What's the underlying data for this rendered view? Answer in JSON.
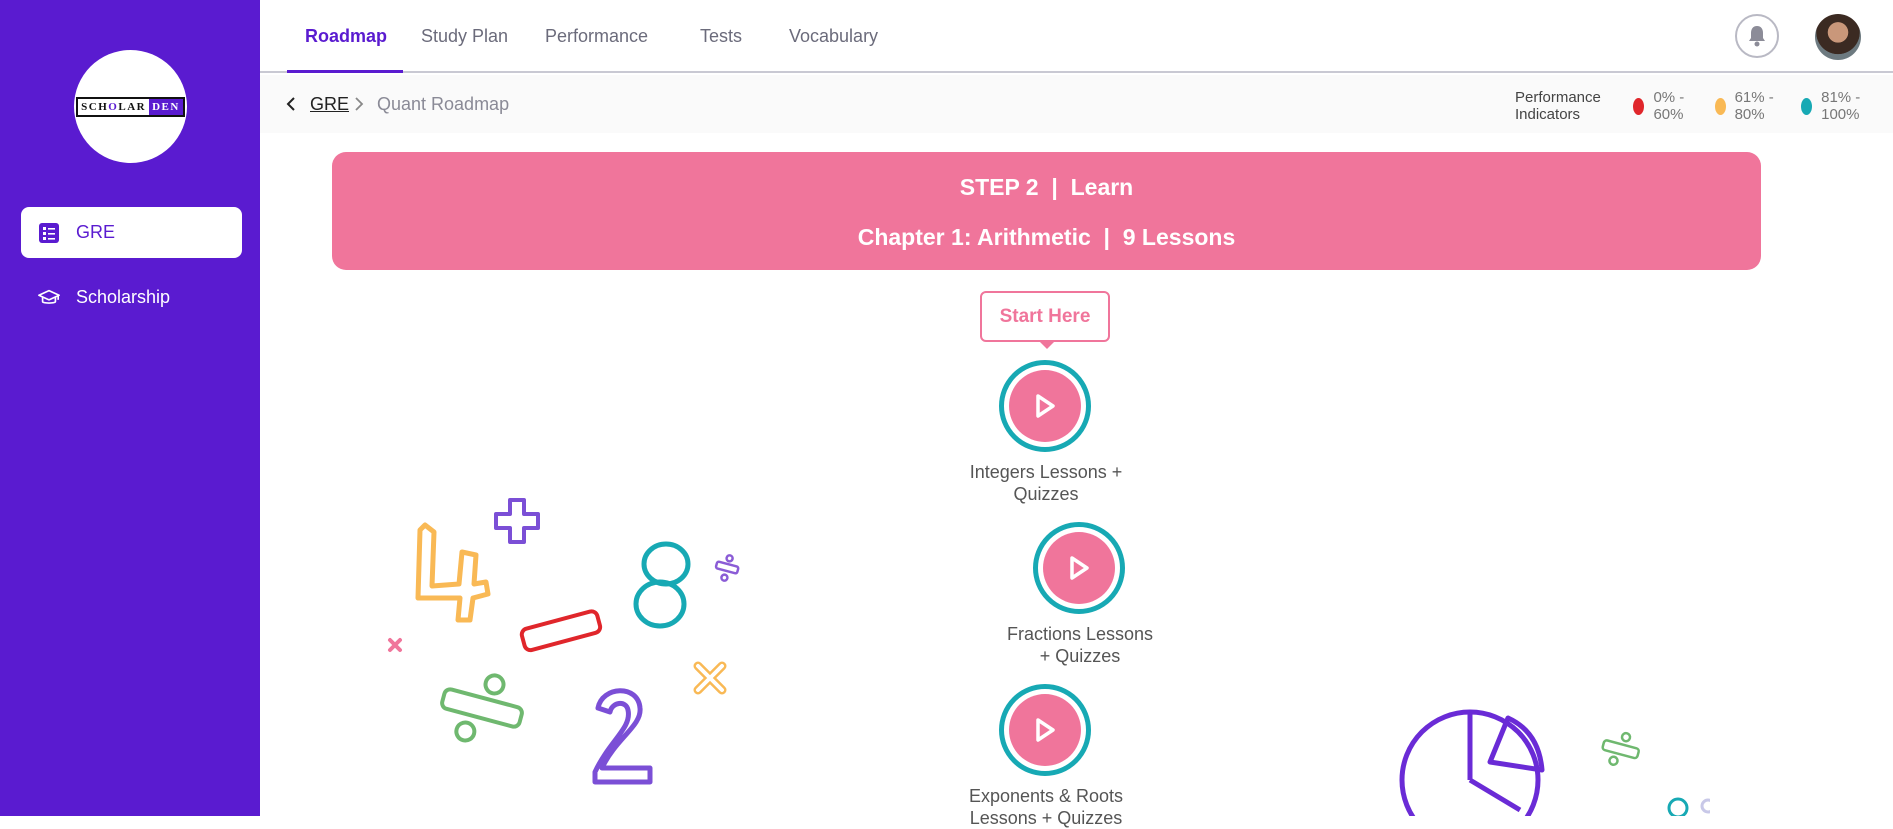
{
  "sidebar": {
    "logo_left": "SCH",
    "logo_mid": "O",
    "logo_l": "LAR",
    "logo_right": "DEN",
    "items": [
      {
        "label": "GRE",
        "icon": "list-icon",
        "active": true
      },
      {
        "label": "Scholarship",
        "icon": "graduation-cap-icon",
        "active": false
      }
    ]
  },
  "header": {
    "tabs": [
      {
        "label": "Roadmap",
        "active": true
      },
      {
        "label": "Study Plan",
        "active": false
      },
      {
        "label": "Performance",
        "active": false
      },
      {
        "label": "Tests",
        "active": false
      },
      {
        "label": "Vocabulary",
        "active": false
      }
    ],
    "bell_icon": "bell-icon",
    "avatar_icon": "user-avatar"
  },
  "breadcrumb": {
    "back_icon": "chevron-left-icon",
    "root": "GRE",
    "sep_icon": "chevron-right-icon",
    "current": "Quant Roadmap"
  },
  "performance": {
    "label": "Performance Indicators",
    "ranges": [
      {
        "range": "0% - 60%",
        "color": "#e0262b"
      },
      {
        "range": "61% - 80%",
        "color": "#f9b955"
      },
      {
        "range": "81% - 100%",
        "color": "#17a9b4"
      }
    ]
  },
  "banner": {
    "step_line": "STEP 2  |  Learn",
    "chapter_line": "Chapter 1: Arithmetic  |  9 Lessons",
    "color": "#f0759b"
  },
  "roadmap": {
    "start_label": "Start Here",
    "lessons": [
      {
        "line1": "Integers Lessons +",
        "line2": "Quizzes"
      },
      {
        "line1": "Fractions Lessons",
        "line2": "+ Quizzes"
      },
      {
        "line1": "Exponents & Roots",
        "line2": "Lessons + Quizzes"
      }
    ]
  },
  "colors": {
    "brand": "#5a1bd0",
    "accent": "#f0759b",
    "ring": "#17a9b4"
  }
}
